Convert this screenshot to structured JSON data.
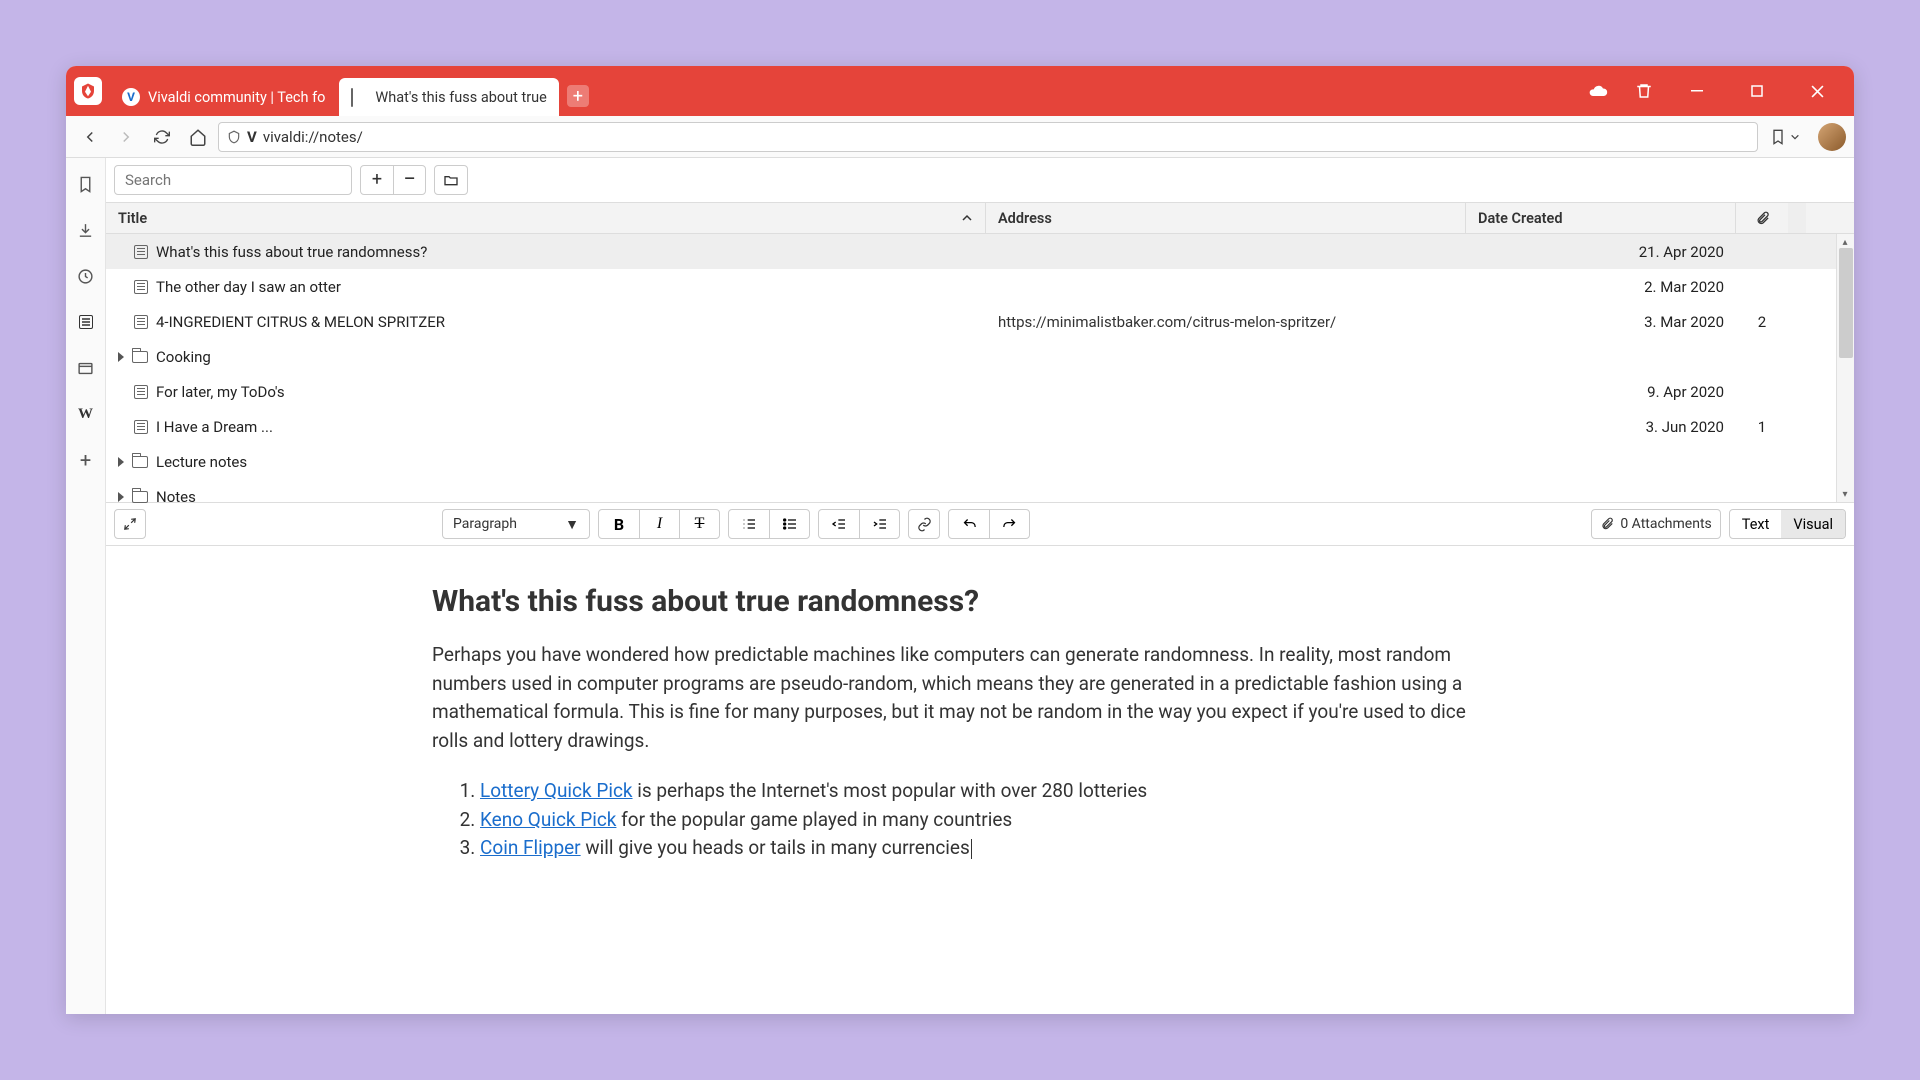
{
  "tabs": [
    {
      "label": "Vivaldi community | Tech fo",
      "active": false
    },
    {
      "label": "What's this fuss about true",
      "active": true
    }
  ],
  "address": {
    "url": "vivaldi://notes/"
  },
  "notes_panel": {
    "search_placeholder": "Search",
    "columns": {
      "title": "Title",
      "address": "Address",
      "date": "Date Created"
    }
  },
  "notes": [
    {
      "type": "note",
      "title": "What's this fuss about true randomness?",
      "address": "",
      "date": "21. Apr 2020",
      "attachments": "",
      "selected": true
    },
    {
      "type": "note",
      "title": "The other day I saw an otter",
      "address": "",
      "date": "2. Mar 2020",
      "attachments": ""
    },
    {
      "type": "note-clip",
      "title": "4-INGREDIENT CITRUS & MELON SPRITZER",
      "address": "https://minimalistbaker.com/citrus-melon-spritzer/",
      "date": "3. Mar 2020",
      "attachments": "2"
    },
    {
      "type": "folder",
      "title": "Cooking",
      "address": "",
      "date": "",
      "attachments": ""
    },
    {
      "type": "note",
      "title": "For later, my ToDo's",
      "address": "",
      "date": "9. Apr 2020",
      "attachments": ""
    },
    {
      "type": "note",
      "title": "I Have a Dream ...",
      "address": "",
      "date": "3. Jun 2020",
      "attachments": "1"
    },
    {
      "type": "folder",
      "title": "Lecture notes",
      "address": "",
      "date": "",
      "attachments": ""
    },
    {
      "type": "folder",
      "title": "Notes",
      "address": "",
      "date": "",
      "attachments": ""
    }
  ],
  "editor": {
    "format_label": "Paragraph",
    "attachments_label": "0 Attachments",
    "mode_text": "Text",
    "mode_visual": "Visual",
    "heading": "What's this fuss about true randomness?",
    "paragraph": "Perhaps you have wondered how predictable machines like computers can generate randomness. In reality, most random numbers used in computer programs are pseudo-random, which means they are generated in a predictable fashion using a mathematical formula. This is fine for many purposes, but it may not be random in the way you expect if you're used to dice rolls and lottery drawings.",
    "list": [
      {
        "link": "Lottery Quick Pick",
        "text": " is perhaps the Internet's most popular with over 280 lotteries"
      },
      {
        "link": "Keno Quick Pick",
        "text": " for the popular game played in many countries"
      },
      {
        "link": "Coin Flipper",
        "text": " will give you heads or tails in many currencies"
      }
    ]
  }
}
